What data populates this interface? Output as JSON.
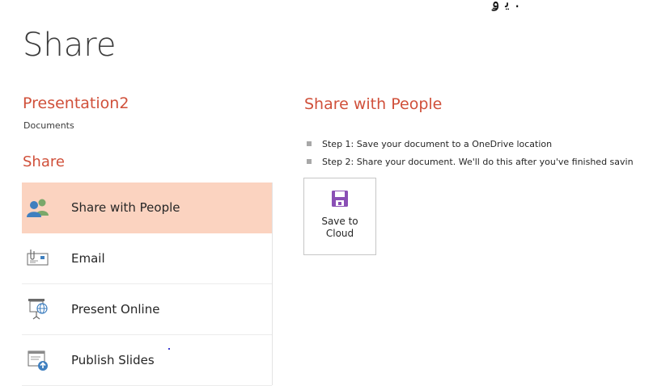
{
  "page": {
    "title": "Share"
  },
  "document": {
    "name": "Presentation2",
    "location": "Documents"
  },
  "sidebar": {
    "heading": "Share",
    "items": [
      {
        "label": "Share with People",
        "icon": "share-people-icon",
        "selected": true
      },
      {
        "label": "Email",
        "icon": "email-icon",
        "selected": false
      },
      {
        "label": "Present Online",
        "icon": "present-online-icon",
        "selected": false
      },
      {
        "label": "Publish Slides",
        "icon": "publish-slides-icon",
        "selected": false
      }
    ]
  },
  "panel": {
    "title": "Share with People",
    "steps": [
      "Step 1: Save your document to a OneDrive location",
      "Step 2: Share your document. We'll do this after you've finished savin"
    ],
    "save_button": {
      "line1": "Save to",
      "line2": "Cloud",
      "icon": "save-floppy-icon"
    }
  },
  "colors": {
    "accent": "#d0503a",
    "selected_bg": "#fbd3c0",
    "save_icon": "#8a4fb5"
  }
}
